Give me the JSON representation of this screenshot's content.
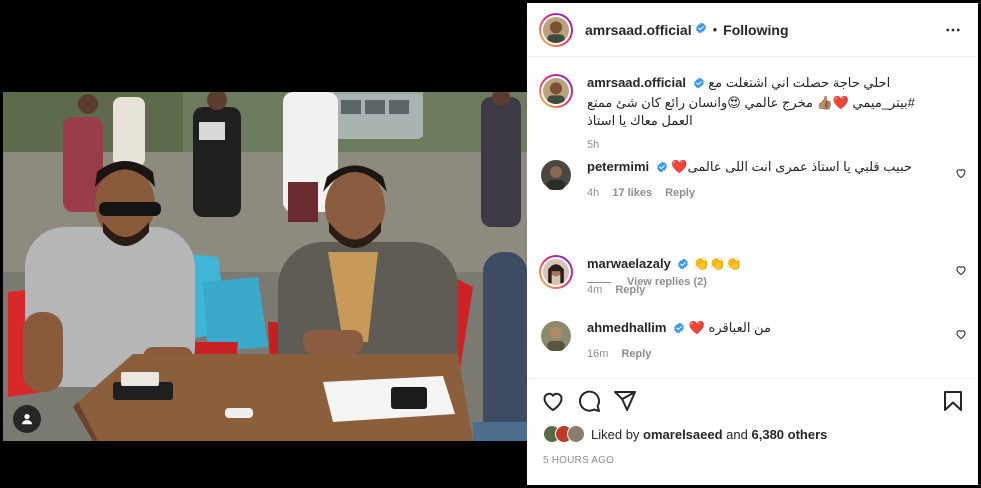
{
  "post": {
    "author": "amrsaad.official",
    "follow_dot": "•",
    "follow_state": "Following",
    "caption": "احلي حاجة حصلت اني اشتغلت مع #بيتر_ميمي ❤️👍🏽 مخرج عالمي 😍وانسان رائع كان شئ ممتع العمل معاك يا استاذ",
    "caption_time": "5h"
  },
  "comments": [
    {
      "user": "petermimi",
      "text": "حبيب قلبي يا استاذ عمرى انت اللى عالمى❤️",
      "time": "4h",
      "likes": "17 likes",
      "reply": "Reply"
    },
    {
      "user": "marwaelazaly",
      "text": "👏👏👏",
      "time": "4m",
      "reply": "Reply"
    },
    {
      "user": "ahmedhallim",
      "text": "من العباقره ❤️",
      "time": "16m",
      "reply": "Reply"
    }
  ],
  "view_replies": "View replies (2)",
  "likes": {
    "prefix": "Liked by",
    "user": "omarelsaeed",
    "and": "and",
    "others": "6,380 others"
  },
  "timestamp": "5 HOURS AGO",
  "colors": {
    "verified": "#3897f0",
    "heart": "#ed4956",
    "muted": "#8e8e8e"
  },
  "icons": [
    "verified-icon",
    "more-icon",
    "heart-icon",
    "comment-icon",
    "share-icon",
    "save-icon",
    "user-tag-icon"
  ]
}
